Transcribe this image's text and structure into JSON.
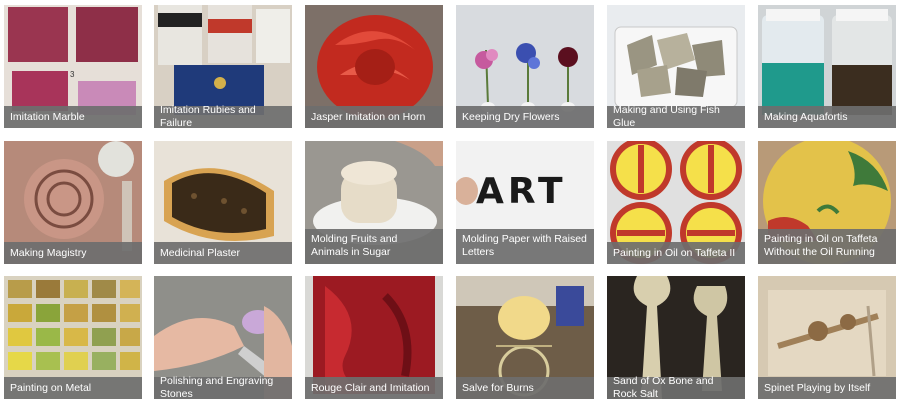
{
  "cards": [
    {
      "title": "Imitation Marble"
    },
    {
      "title": "Imitation Rubies and Failure"
    },
    {
      "title": "Jasper Imitation on Horn"
    },
    {
      "title": "Keeping Dry Flowers"
    },
    {
      "title": "Making and Using Fish Glue"
    },
    {
      "title": "Making Aquafortis"
    },
    {
      "title": "Making Magistry"
    },
    {
      "title": "Medicinal Plaster"
    },
    {
      "title": "Molding Fruits and Animals in Sugar"
    },
    {
      "title": "Molding Paper with Raised Letters"
    },
    {
      "title": "Painting in Oil on Taffeta II"
    },
    {
      "title": "Painting in Oil on Taffeta Without the Oil Running"
    },
    {
      "title": "Painting on Metal"
    },
    {
      "title": "Polishing and Engraving Stones"
    },
    {
      "title": "Rouge Clair and Imitation"
    },
    {
      "title": "Salve for Burns"
    },
    {
      "title": "Sand of Ox Bone and Rock Salt"
    },
    {
      "title": "Spinet Playing by Itself"
    }
  ],
  "thumb_texts": {
    "art_word": "ART"
  },
  "colors": {
    "caption_bg": "#6e6e6e",
    "caption_text": "#ffffff"
  }
}
